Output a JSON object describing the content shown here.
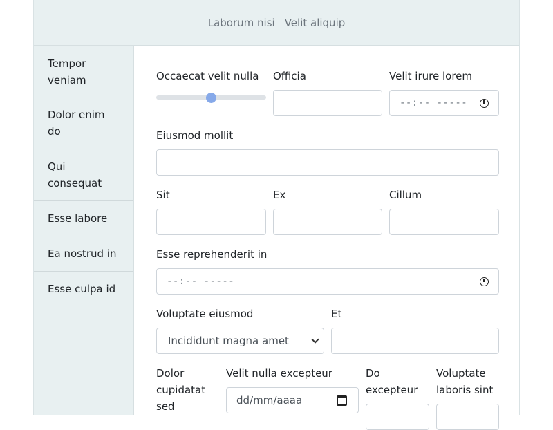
{
  "header": {
    "links": [
      "Laborum nisi",
      "Velit aliquip"
    ]
  },
  "sidebar": {
    "items": [
      "Tempor veniam",
      "Dolor enim do",
      "Qui consequat",
      "Esse labore",
      "Ea nostrud in",
      "Esse culpa id"
    ]
  },
  "form": {
    "occaecat": {
      "label": "Occaecat velit nulla",
      "value": 0.5
    },
    "officia": {
      "label": "Officia",
      "value": ""
    },
    "velit_irure": {
      "label": "Velit irure lorem",
      "placeholder": "--:-- -----"
    },
    "eiusmod": {
      "label": "Eiusmod mollit",
      "value": ""
    },
    "sit": {
      "label": "Sit",
      "value": ""
    },
    "ex": {
      "label": "Ex",
      "value": ""
    },
    "cillum": {
      "label": "Cillum",
      "value": ""
    },
    "esse_rep": {
      "label": "Esse reprehenderit in",
      "placeholder": "--:-- -----"
    },
    "voluptate_eiusmod": {
      "label": "Voluptate eiusmod",
      "selected": "Incididunt magna amet"
    },
    "et": {
      "label": "Et",
      "value": ""
    },
    "dolor_cupidatat": {
      "label": "Dolor cupidatat sed"
    },
    "velit_nulla": {
      "label": "Velit nulla excepteur",
      "placeholder": "dd/mm/aaaa"
    },
    "do_excepteur": {
      "label": "Do excepteur"
    },
    "voluptate_laboris": {
      "label": "Voluptate laboris sint"
    }
  },
  "icons": {
    "time": "clock-icon",
    "date": "calendar-icon",
    "select": "chevron-down-icon"
  },
  "colors": {
    "header_bg": "#e8f0f1",
    "slider_thumb": "#86a9e9"
  }
}
